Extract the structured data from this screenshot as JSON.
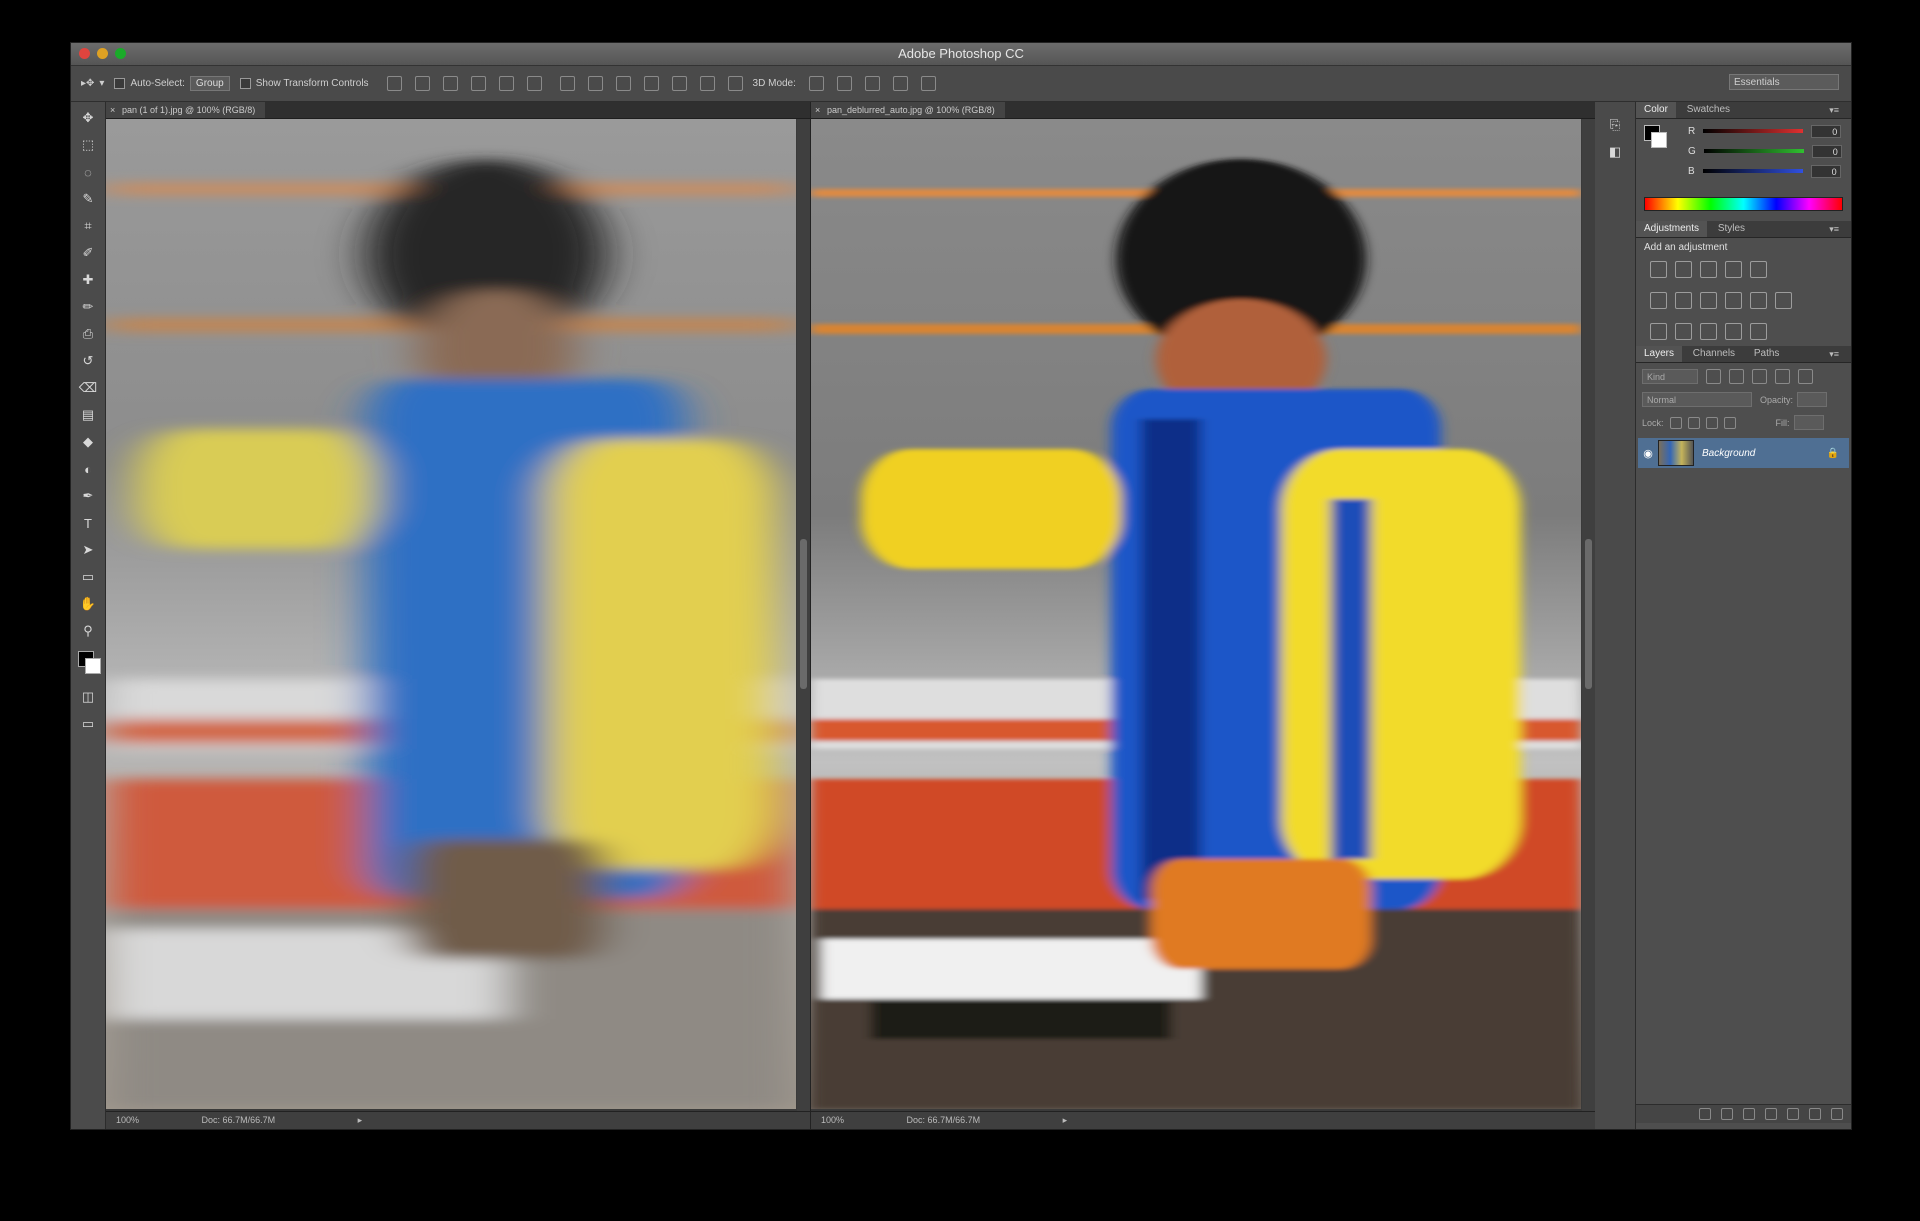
{
  "window": {
    "title": "Adobe Photoshop CC"
  },
  "options_bar": {
    "auto_select_label": "Auto-Select:",
    "auto_select_value": "Group",
    "show_transform_label": "Show Transform Controls",
    "mode_3d_label": "3D Mode:",
    "workspace": "Essentials"
  },
  "documents": [
    {
      "tab_title": "pan (1 of 1).jpg @ 100% (RGB/8)",
      "zoom": "100%",
      "doc_size": "Doc: 66.7M/66.7M"
    },
    {
      "tab_title": "pan_deblurred_auto.jpg @ 100% (RGB/8)",
      "zoom": "100%",
      "doc_size": "Doc: 66.7M/66.7M"
    }
  ],
  "color_panel": {
    "tabs": [
      "Color",
      "Swatches"
    ],
    "channels": [
      {
        "label": "R",
        "value": "0",
        "color": "#e03030"
      },
      {
        "label": "G",
        "value": "0",
        "color": "#30c030"
      },
      {
        "label": "B",
        "value": "0",
        "color": "#3050e0"
      }
    ]
  },
  "adjustments_panel": {
    "tabs": [
      "Adjustments",
      "Styles"
    ],
    "heading": "Add an adjustment"
  },
  "layers_panel": {
    "tabs": [
      "Layers",
      "Channels",
      "Paths"
    ],
    "filter_kind": "Kind",
    "blend_mode": "Normal",
    "opacity_label": "Opacity:",
    "lock_label": "Lock:",
    "fill_label": "Fill:",
    "layers": [
      {
        "name": "Background",
        "visible": true,
        "locked": true
      }
    ]
  },
  "tools": [
    "move-tool",
    "marquee-tool",
    "lasso-tool",
    "quick-select-tool",
    "crop-tool",
    "eyedropper-tool",
    "healing-brush-tool",
    "brush-tool",
    "clone-stamp-tool",
    "history-brush-tool",
    "eraser-tool",
    "gradient-tool",
    "blur-tool",
    "dodge-tool",
    "pen-tool",
    "type-tool",
    "path-select-tool",
    "shape-tool",
    "hand-tool",
    "zoom-tool"
  ]
}
